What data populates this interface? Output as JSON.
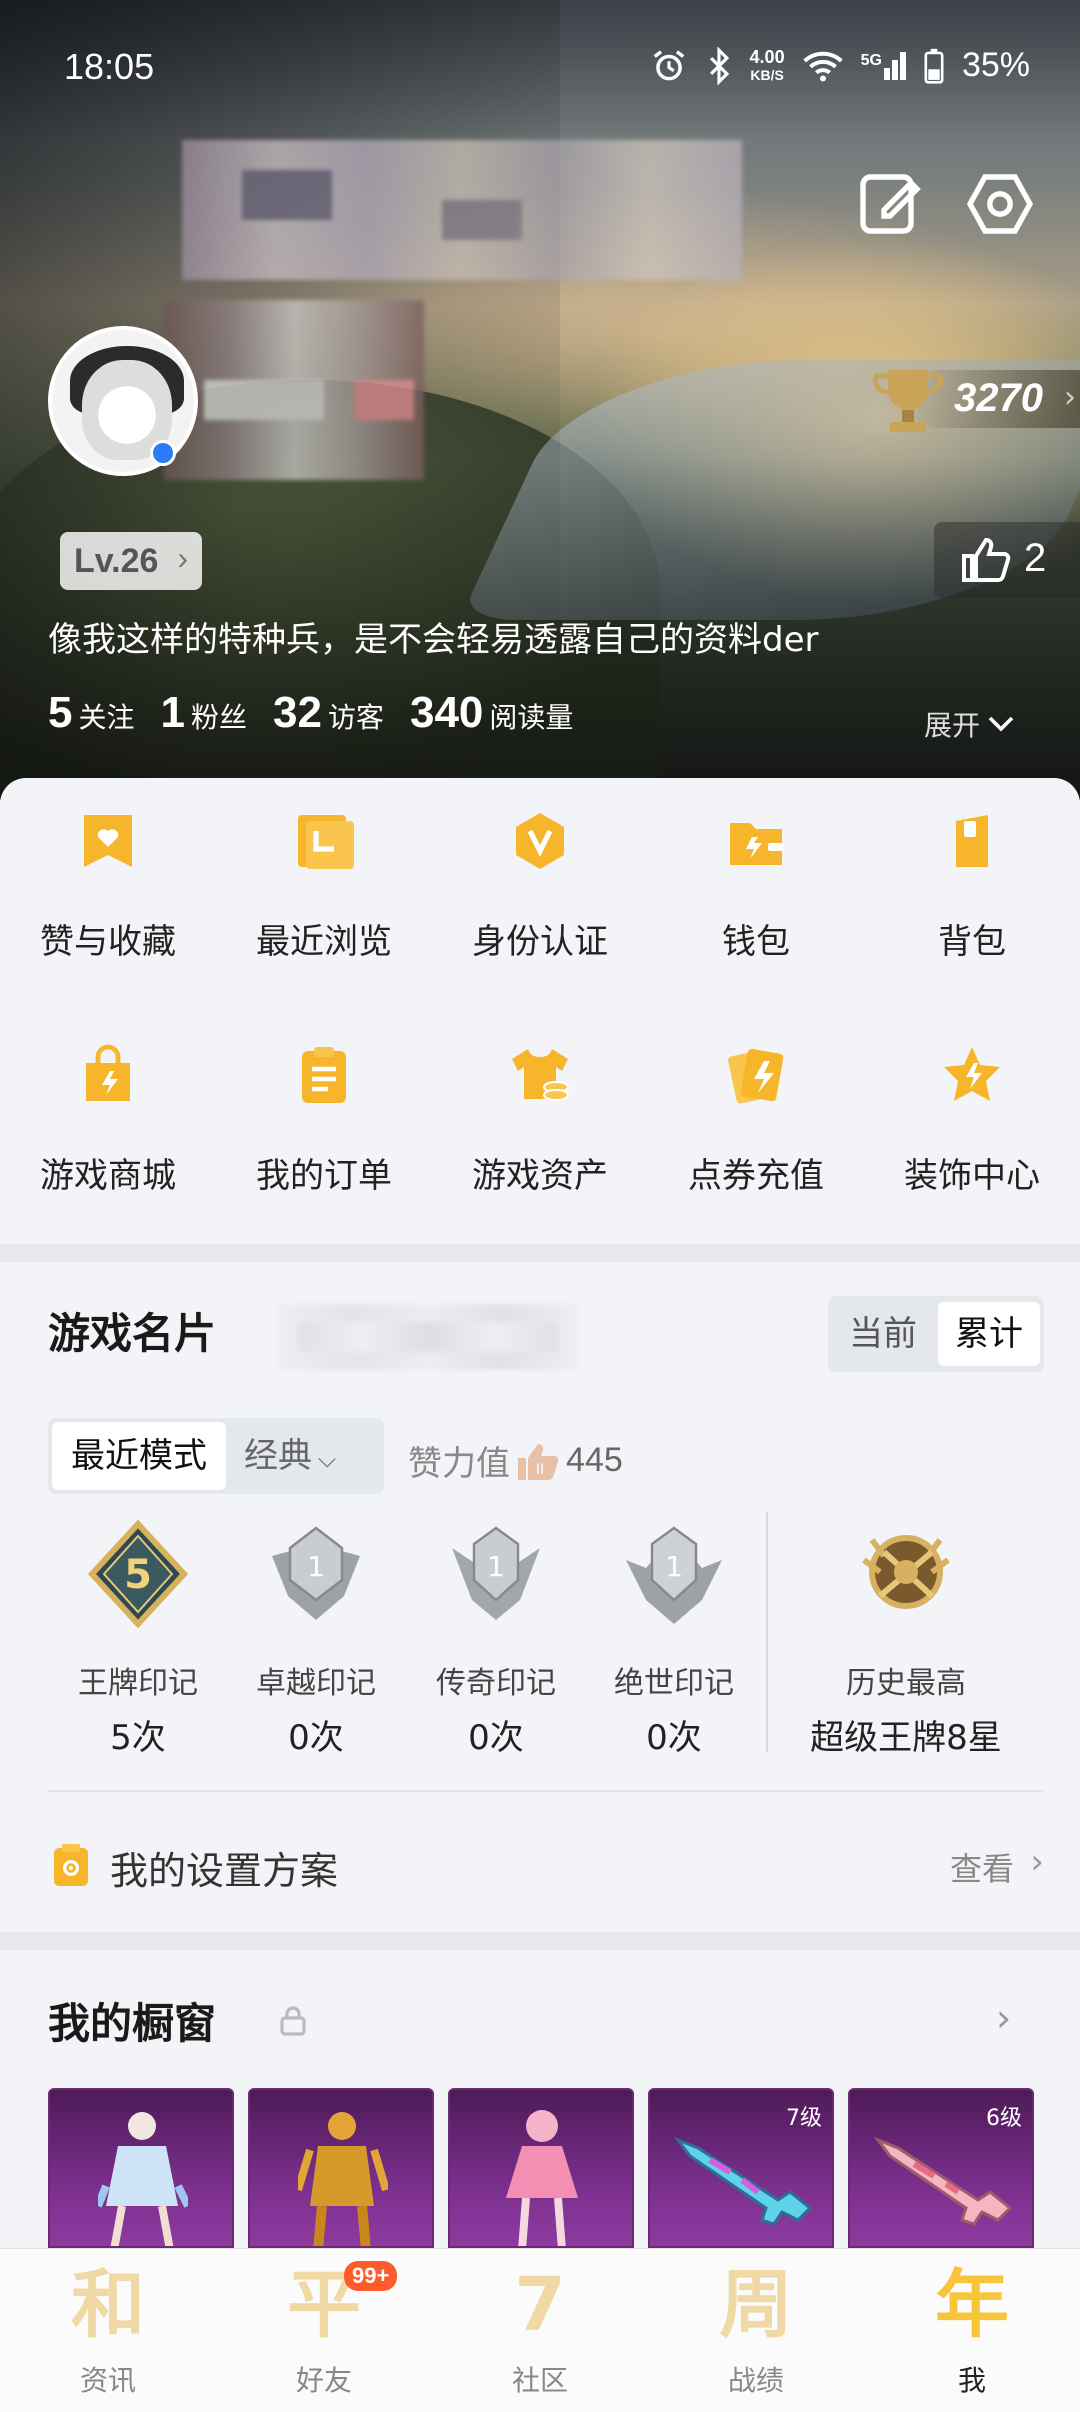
{
  "status_bar": {
    "time": "18:05",
    "net_speed": "4.00",
    "net_unit": "KB/S",
    "network": "5G",
    "battery": "35%"
  },
  "profile": {
    "level": "Lv.26",
    "trophy_score": "3270",
    "likes": "2",
    "bio": "像我这样的特种兵，是不会轻易透露自己的资料der",
    "stats": [
      {
        "num": "5",
        "label": "关注"
      },
      {
        "num": "1",
        "label": "粉丝"
      },
      {
        "num": "32",
        "label": "访客"
      },
      {
        "num": "340",
        "label": "阅读量"
      }
    ],
    "expand_label": "展开"
  },
  "features": [
    {
      "label": "赞与收藏",
      "icon": "heart-folder-icon"
    },
    {
      "label": "最近浏览",
      "icon": "history-icon"
    },
    {
      "label": "身份认证",
      "icon": "verify-badge-icon"
    },
    {
      "label": "钱包",
      "icon": "wallet-icon"
    },
    {
      "label": "背包",
      "icon": "backpack-icon"
    },
    {
      "label": "游戏商城",
      "icon": "shopping-bag-icon"
    },
    {
      "label": "我的订单",
      "icon": "order-clipboard-icon"
    },
    {
      "label": "游戏资产",
      "icon": "tshirt-coins-icon"
    },
    {
      "label": "点券充值",
      "icon": "voucher-icon"
    },
    {
      "label": "装饰中心",
      "icon": "star-decor-icon"
    }
  ],
  "game_card": {
    "title": "游戏名片",
    "toggle": [
      "当前",
      "累计"
    ],
    "mode_label": "最近模式",
    "mode_value": "经典",
    "zanli_label": "赞力值",
    "zanli_value": "445",
    "badges": [
      {
        "name": "王牌印记",
        "count": "5次",
        "badge_number": "5"
      },
      {
        "name": "卓越印记",
        "count": "0次",
        "badge_number": "1"
      },
      {
        "name": "传奇印记",
        "count": "0次",
        "badge_number": "1"
      },
      {
        "name": "绝世印记",
        "count": "0次",
        "badge_number": "1"
      }
    ],
    "history_label": "历史最高",
    "history_value": "超级王牌8星",
    "settings_label": "我的设置方案",
    "settings_view": "查看"
  },
  "showcase": {
    "title": "我的橱窗",
    "items": [
      {
        "level": ""
      },
      {
        "level": ""
      },
      {
        "level": ""
      },
      {
        "level": "7级"
      },
      {
        "level": "6级"
      }
    ]
  },
  "bottom_nav": [
    {
      "glyph": "和",
      "label": "资讯",
      "badge": ""
    },
    {
      "glyph": "平",
      "label": "好友",
      "badge": "99+"
    },
    {
      "glyph": "7",
      "label": "社区",
      "badge": ""
    },
    {
      "glyph": "周",
      "label": "战绩",
      "badge": ""
    },
    {
      "glyph": "年",
      "label": "我",
      "badge": ""
    }
  ],
  "colors": {
    "accent": "#f7b52c",
    "badge_red": "#ff5a2a",
    "showcase_purple": "#7a2f8c"
  }
}
